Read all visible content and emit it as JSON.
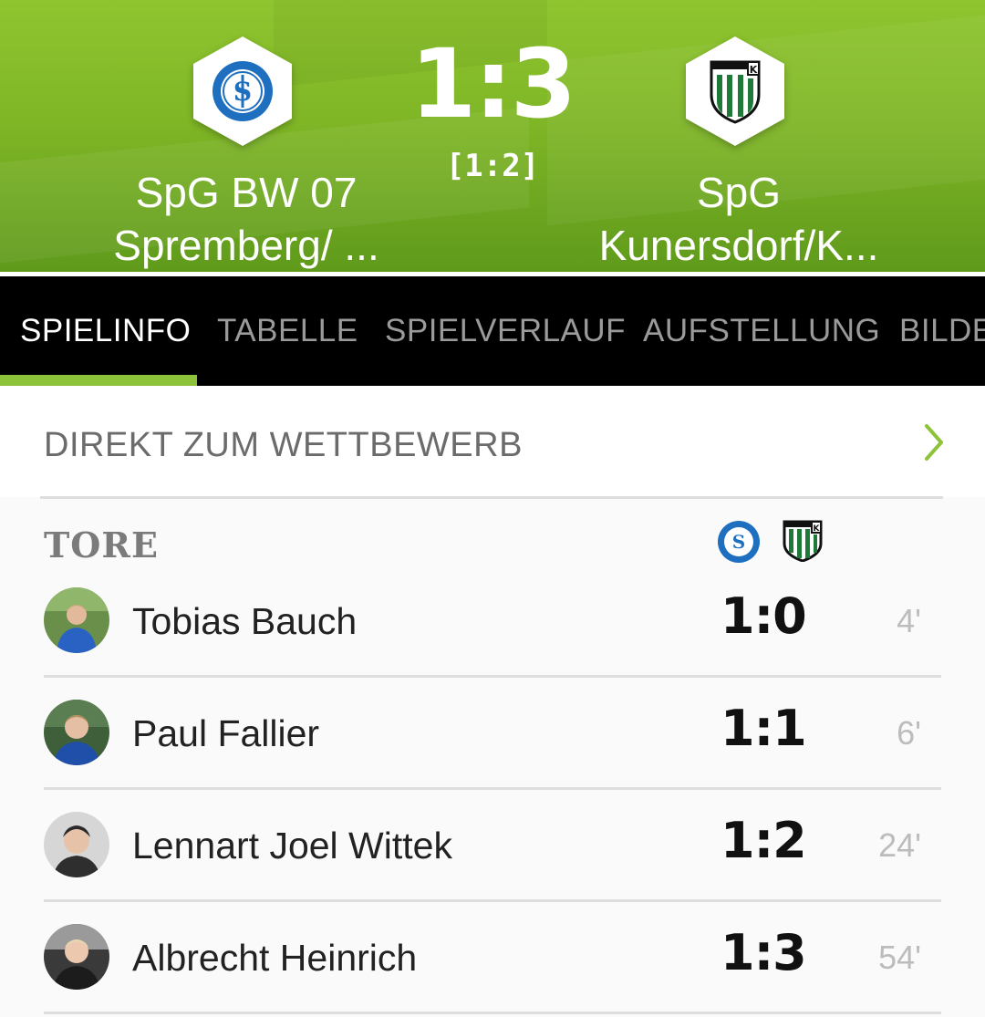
{
  "match": {
    "home": {
      "name_line1": "SpG BW 07",
      "name_line2": "Spremberg/ ...",
      "crest": "sv-blau-weiss-07-crest"
    },
    "away": {
      "name_line1": "SpG",
      "name_line2": "Kunersdorf/K...",
      "crest": "kunersdorf-crest"
    },
    "score": "1:3",
    "halftime": "[1:2]"
  },
  "tabs": [
    {
      "label": "SPIELINFO",
      "active": true
    },
    {
      "label": "TABELLE",
      "active": false
    },
    {
      "label": "SPIELVERLAUF",
      "active": false
    },
    {
      "label": "AUFSTELLUNG",
      "active": false
    },
    {
      "label": "BILDE",
      "active": false
    }
  ],
  "competition_link": {
    "label": "DIREKT ZUM WETTBEWERB",
    "icon": "chevron-right-icon"
  },
  "goals": {
    "title": "TORE",
    "items": [
      {
        "player": "Tobias Bauch",
        "score": "1:0",
        "minute": "4'"
      },
      {
        "player": "Paul Fallier",
        "score": "1:1",
        "minute": "6'"
      },
      {
        "player": "Lennart Joel Wittek",
        "score": "1:2",
        "minute": "24'"
      },
      {
        "player": "Albrecht Heinrich",
        "score": "1:3",
        "minute": "54'"
      }
    ]
  },
  "colors": {
    "header_green": "#7fb626",
    "accent_green": "#8dc33a",
    "tab_bar": "#000000",
    "home_blue": "#1e6fc0",
    "away_green": "#1f7a3a"
  }
}
